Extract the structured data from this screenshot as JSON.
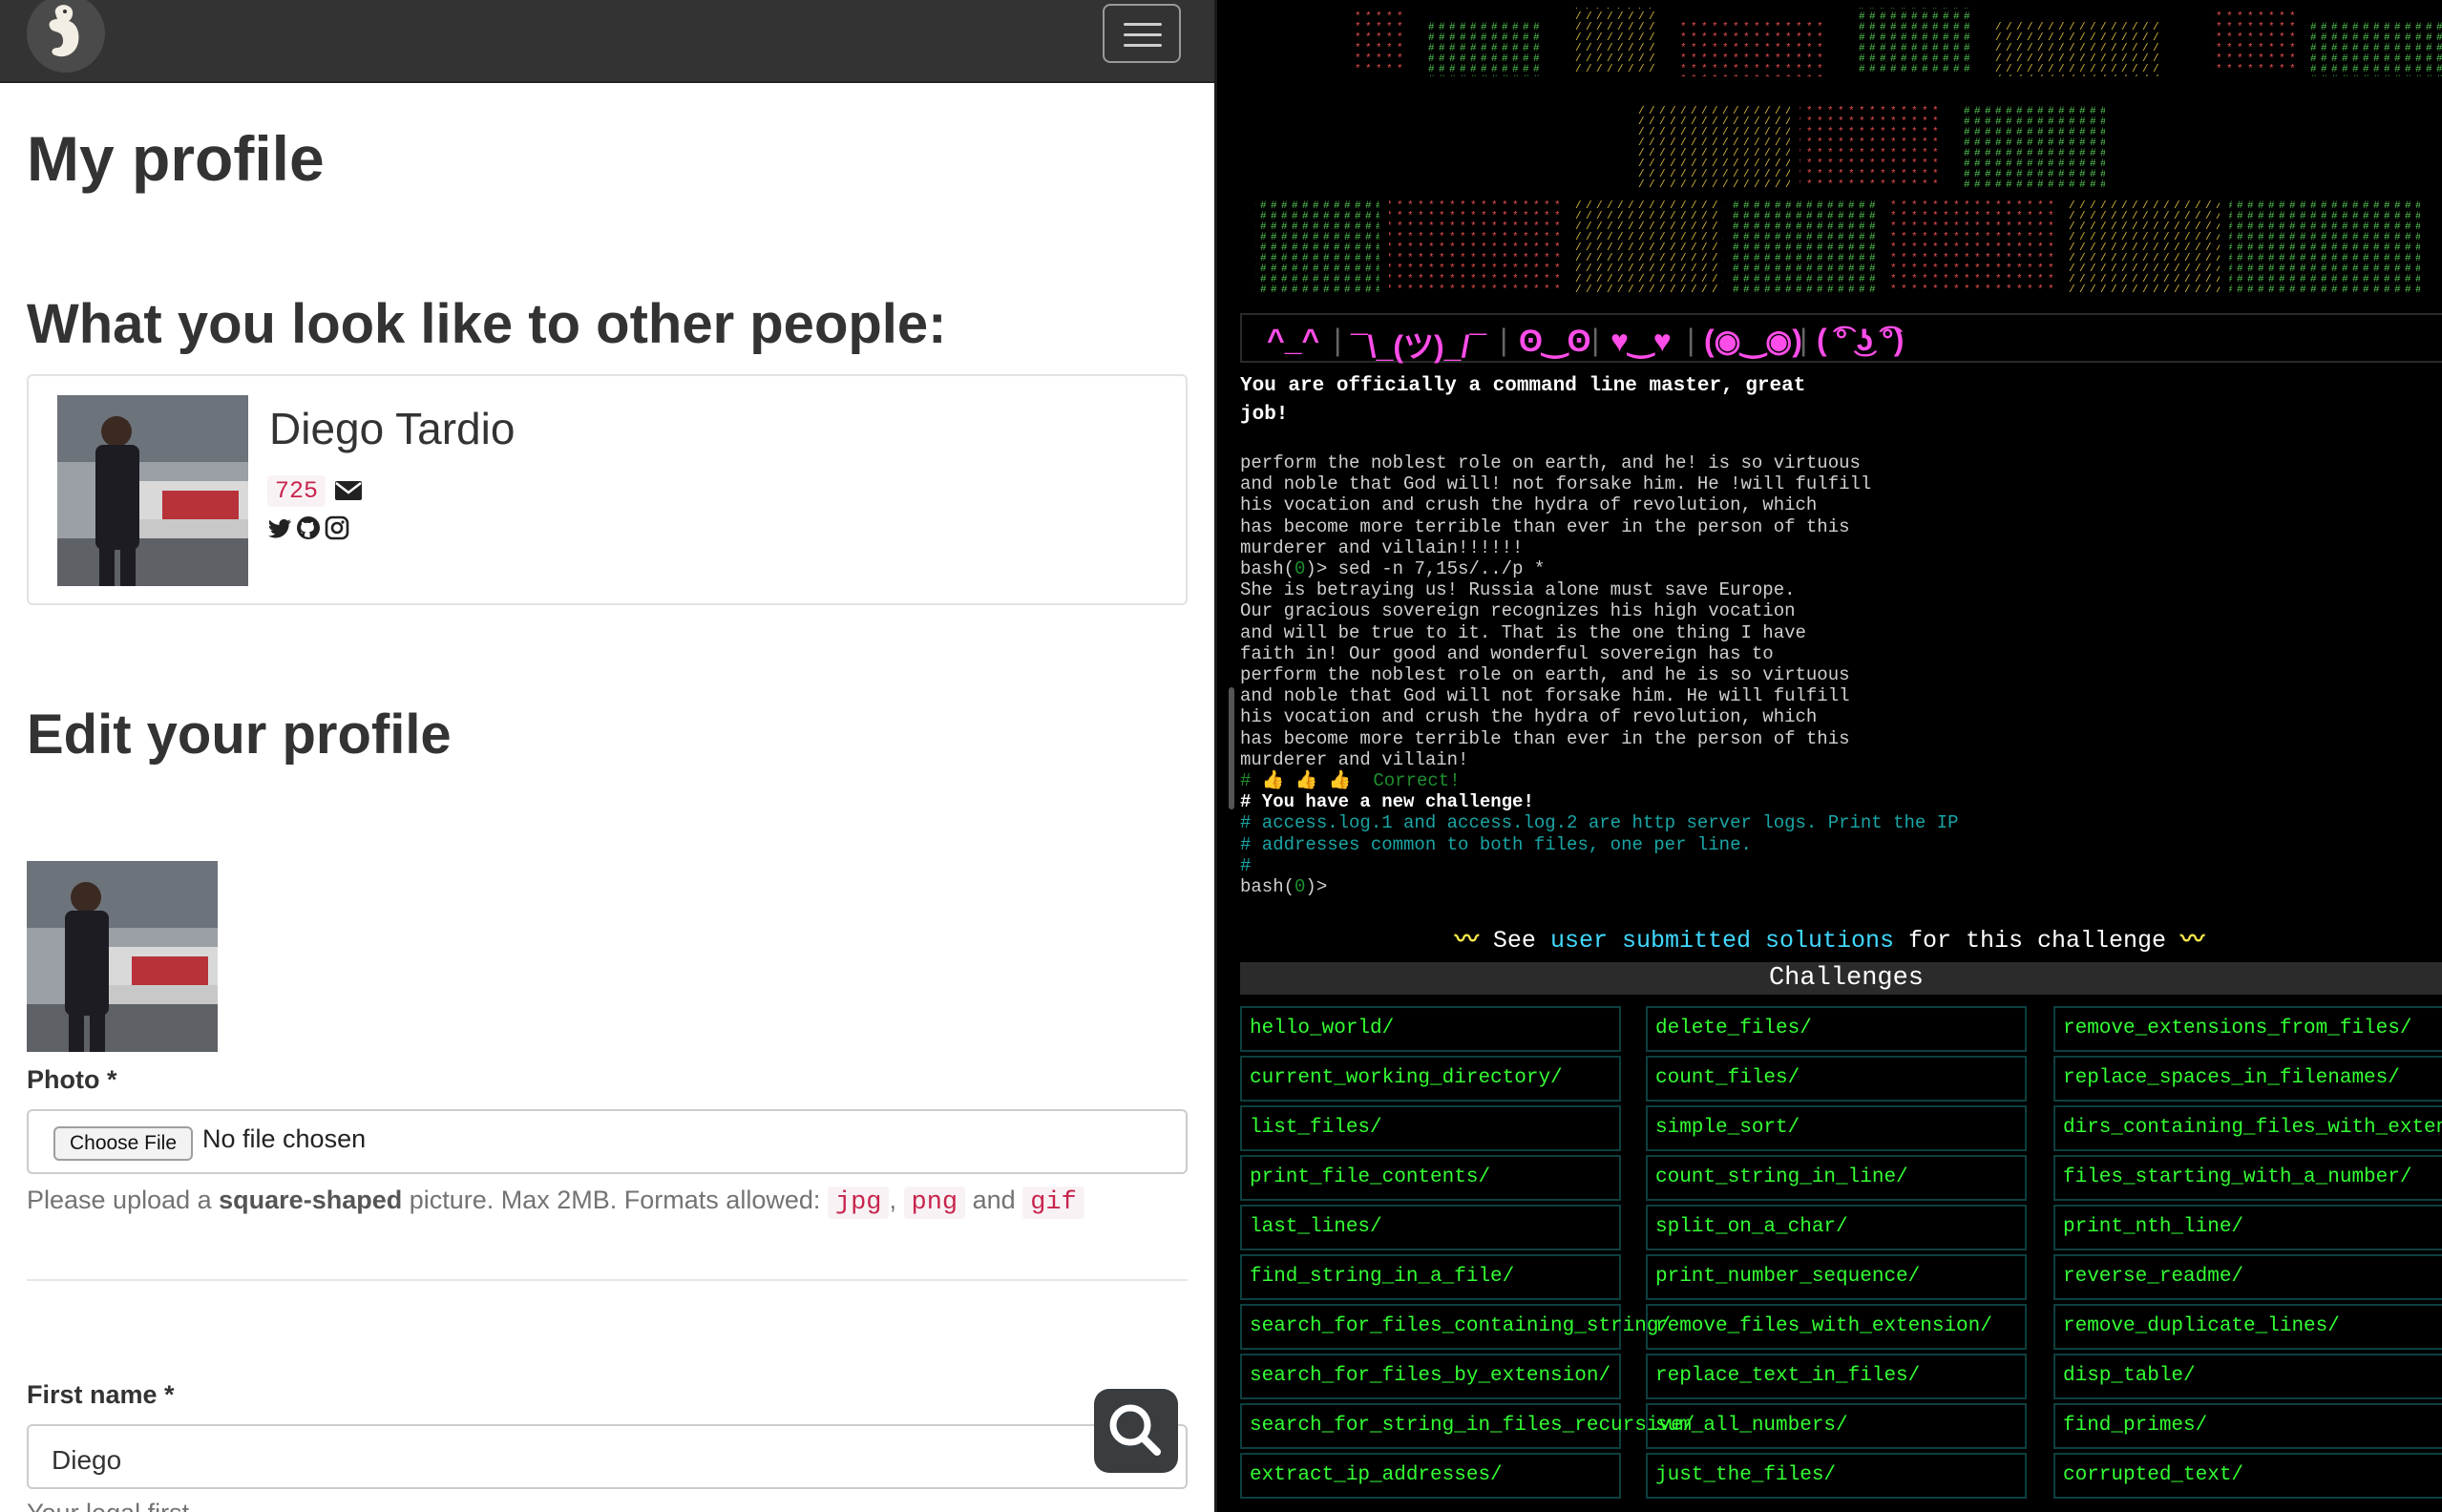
{
  "left": {
    "page_title": "My profile",
    "section_title": "What you look like to other people:",
    "profile": {
      "name": "Diego Tardio",
      "points": "725"
    },
    "edit_title": "Edit your profile",
    "photo_label": "Photo *",
    "file_input": {
      "button": "Choose File",
      "status": "No file chosen"
    },
    "help": {
      "pre": "Please upload a ",
      "bold": "square-shaped",
      "mid": " picture. Max 2MB. Formats allowed: ",
      "fmt1": "jpg",
      "comma": ",",
      "fmt2": "png",
      "and": "and",
      "fmt3": "gif"
    },
    "first_name_label": "First name *",
    "first_name_value": "Diego",
    "first_name_help": "Your legal first..."
  },
  "right": {
    "emoticons": [
      "^_^",
      "¯\\_(ツ)_/¯",
      "ʘ‿ʘ",
      "♥‿♥",
      "(◉‿◉)",
      "( ͡° ͜ʖ ͡°)"
    ],
    "officially": "You are officially a command line master, great job!",
    "terminal_lines": [
      "perform the noblest role on earth, and he! is so virtuous",
      "and noble that God will! not forsake him. He !will fulfill",
      "his vocation and crush the hydra of revolution, which",
      "has become more terrible than ever in the person of this",
      "murderer and villain!!!!!!",
      "She is betraying us! Russia alone must save Europe.",
      "Our gracious sovereign recognizes his high vocation",
      "and will be true to it. That is the one thing I have",
      "faith in! Our good and wonderful sovereign has to",
      "perform the noblest role on earth, and he is so virtuous",
      "and noble that God will not forsake him. He will fulfill",
      "his vocation and crush the hydra of revolution, which",
      "has become more terrible than ever in the person of this",
      "murderer and villain!"
    ],
    "prompt_bash": "bash(",
    "prompt_zero": "0",
    "prompt_close": ")>",
    "sed_command": " sed -n 7,15s/../p *",
    "thumbs": "# 👍 👍 👍  Correct!",
    "new_challenge": "# You have a new challenge!",
    "challenge_text_1": "# access.log.1 and access.log.2 are http server logs. Print the IP",
    "challenge_text_2": "# addresses common to both files, one per line.",
    "hash_line": "#",
    "see": {
      "deco": "〰",
      "pre": " See ",
      "link": "user submitted solutions",
      "post": " for this challenge "
    },
    "challenges_header": "Challenges",
    "challenges": [
      [
        "hello_world/",
        "delete_files/",
        "remove_extensions_from_files/"
      ],
      [
        "current_working_directory/",
        "count_files/",
        "replace_spaces_in_filenames/"
      ],
      [
        "list_files/",
        "simple_sort/",
        "dirs_containing_files_with_extension/"
      ],
      [
        "print_file_contents/",
        "count_string_in_line/",
        "files_starting_with_a_number/"
      ],
      [
        "last_lines/",
        "split_on_a_char/",
        "print_nth_line/"
      ],
      [
        "find_string_in_a_file/",
        "print_number_sequence/",
        "reverse_readme/"
      ],
      [
        "search_for_files_containing_string/",
        "remove_files_with_extension/",
        "remove_duplicate_lines/"
      ],
      [
        "search_for_files_by_extension/",
        "replace_text_in_files/",
        "disp_table/"
      ],
      [
        "search_for_string_in_files_recursive/",
        "sum_all_numbers/",
        "find_primes/"
      ],
      [
        "extract_ip_addresses/",
        "just_the_files/",
        "corrupted_text/"
      ]
    ]
  },
  "colors": {
    "navbar": "#333333",
    "terminal_bg": "#000000",
    "challenge_text": "#33ff33",
    "emoticon": "#ff4de9",
    "link": "#41d9ff",
    "code_red": "#c7254e"
  }
}
